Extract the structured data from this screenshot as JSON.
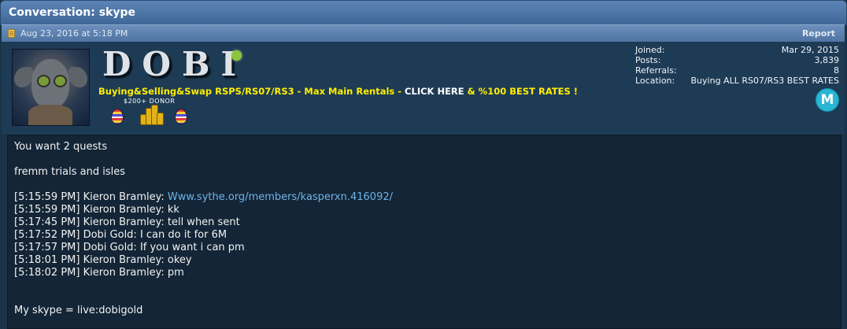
{
  "header": {
    "title": "Conversation: skype"
  },
  "post": {
    "date": "Aug 23, 2016 at 5:18 PM",
    "report_label": "Report"
  },
  "user": {
    "display_logo": "DOBI",
    "signature": {
      "part1": "Buying&Selling&Swap RSPS/RS07/RS3 - Max Main Rentals - ",
      "part2": "CLICK HERE",
      "part3": " & %100 BEST RATES !"
    },
    "donor_label": "$200+ DONOR",
    "badge_icons": [
      "easter-egg-icon",
      "gold-coins-icon",
      "easter-egg-icon"
    ],
    "online_color": "#8cc63f",
    "member_badge": "M",
    "stats": [
      {
        "label": "Joined:",
        "value": "Mar 29, 2015"
      },
      {
        "label": "Posts:",
        "value": "3,839"
      },
      {
        "label": "Referrals:",
        "value": "8"
      },
      {
        "label": "Location:",
        "value": "Buying ALL RS07/RS3 BEST RATES"
      }
    ]
  },
  "message": {
    "lines": [
      "You want 2 quests",
      "fremm trials and isles",
      "[5:15:59 PM] Kieron Bramley: ",
      "[5:15:59 PM] Kieron Bramley: kk",
      "[5:17:45 PM] Kieron Bramley: tell when sent",
      "[5:17:52 PM] Dobi Gold: I can do it for 6M",
      "[5:17:57 PM] Dobi Gold: If you want i can pm",
      "[5:18:01 PM] Kieron Bramley: okey",
      "[5:18:02 PM] Kieron Bramley: pm",
      "My skype = live:dobigold"
    ],
    "link_text": "Www.sythe.org/members/kasperxn.416092/"
  },
  "colors": {
    "title_bar": "#4a72a4",
    "link": "#6fb3e6",
    "signature_yellow": "#ffee00",
    "member_badge": "#29b6d3"
  }
}
